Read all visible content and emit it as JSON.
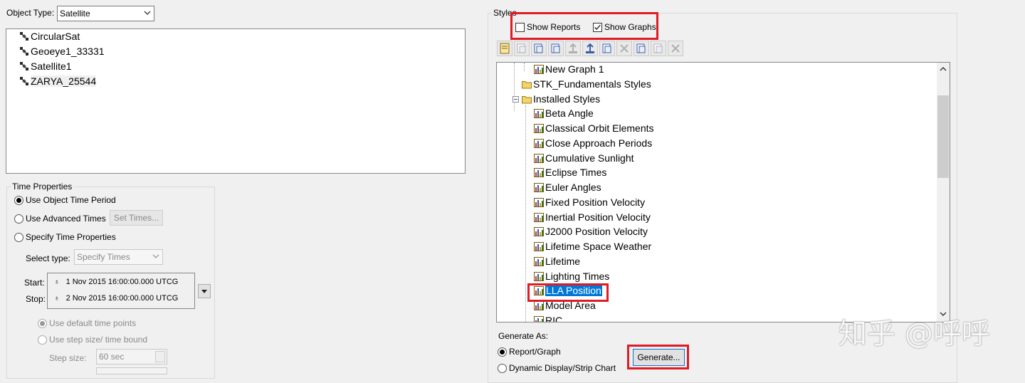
{
  "left": {
    "object_type_label": "Object Type:",
    "object_type_value": "Satellite",
    "satellites": [
      {
        "name": "CircularSat"
      },
      {
        "name": "Geoeye1_33331"
      },
      {
        "name": "Satellite1"
      },
      {
        "name": "ZARYA_25544"
      }
    ],
    "time_properties": {
      "title": "Time Properties",
      "use_object_time_period": "Use Object Time Period",
      "use_advanced_times": "Use Advanced Times",
      "set_times_button": "Set Times...",
      "specify_time_properties": "Specify Time Properties",
      "select_type_label": "Select type:",
      "select_type_value": "Specify Times",
      "start_label": "Start:",
      "start_value": "1 Nov 2015 16:00:00.000 UTCG",
      "stop_label": "Stop:",
      "stop_value": "2 Nov 2015 16:00:00.000 UTCG",
      "use_default_time_points": "Use default time points",
      "use_step_size": "Use step size/ time bound",
      "step_size_label": "Step size:",
      "step_size_value": "60 sec"
    }
  },
  "right": {
    "styles_label": "Styles",
    "show_reports": "Show Reports",
    "show_reports_checked": false,
    "show_graphs": "Show Graphs",
    "show_graphs_checked": true,
    "toolbar_icons": [
      "new-style-icon",
      "new-folder-icon",
      "properties-icon",
      "edit-graph-icon",
      "import-icon",
      "export-icon",
      "duplicate-icon",
      "cut-icon",
      "copy-icon",
      "paste-icon",
      "delete-icon"
    ],
    "tree": [
      {
        "label": "New Graph 1",
        "kind": "graph"
      },
      {
        "label": "STK_Fundamentals Styles",
        "kind": "folder"
      },
      {
        "label": "Installed Styles",
        "kind": "folder-open"
      },
      {
        "label": "Beta Angle",
        "kind": "graph"
      },
      {
        "label": "Classical Orbit Elements",
        "kind": "graph"
      },
      {
        "label": "Close Approach Periods",
        "kind": "graph"
      },
      {
        "label": "Cumulative Sunlight",
        "kind": "graph"
      },
      {
        "label": "Eclipse Times",
        "kind": "graph"
      },
      {
        "label": "Euler Angles",
        "kind": "graph"
      },
      {
        "label": "Fixed Position Velocity",
        "kind": "graph"
      },
      {
        "label": "Inertial Position Velocity",
        "kind": "graph"
      },
      {
        "label": "J2000 Position Velocity",
        "kind": "graph"
      },
      {
        "label": "Lifetime Space Weather",
        "kind": "graph"
      },
      {
        "label": "Lifetime",
        "kind": "graph"
      },
      {
        "label": "Lighting Times",
        "kind": "graph"
      },
      {
        "label": "LLA Position",
        "kind": "graph",
        "selected": true
      },
      {
        "label": "Model Area",
        "kind": "graph"
      },
      {
        "label": "RIC",
        "kind": "graph"
      }
    ],
    "generate_as_label": "Generate As:",
    "report_graph": "Report/Graph",
    "dynamic_display": "Dynamic Display/Strip Chart",
    "generate_button": "Generate..."
  },
  "watermark": "知乎 @呼呼",
  "colors": {
    "highlight_box": "#e01b24",
    "selection": "#0078d7"
  }
}
